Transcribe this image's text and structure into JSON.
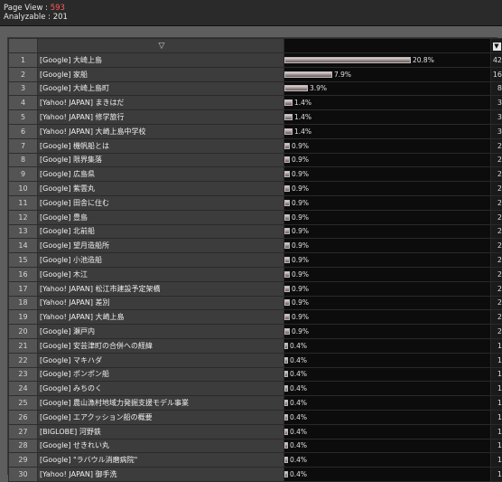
{
  "summary": {
    "page_view_label": "Page View : ",
    "page_view_value": "593",
    "analyzable_label": "Analyzable : 201"
  },
  "table": {
    "sort_icon": "▽",
    "count_sort_icon": "▼",
    "max_percent": 20.8,
    "rows": [
      {
        "idx": "1",
        "keyword": "[Google] 大崎上島",
        "pct": 20.8,
        "pct_label": "20.8%",
        "count": "42"
      },
      {
        "idx": "2",
        "keyword": "[Google] 家船",
        "pct": 7.9,
        "pct_label": "7.9%",
        "count": "16"
      },
      {
        "idx": "3",
        "keyword": "[Google] 大崎上島町",
        "pct": 3.9,
        "pct_label": "3.9%",
        "count": "8"
      },
      {
        "idx": "4",
        "keyword": "[Yahoo! JAPAN] まきはだ",
        "pct": 1.4,
        "pct_label": "1.4%",
        "count": "3"
      },
      {
        "idx": "5",
        "keyword": "[Yahoo! JAPAN] 修学旅行",
        "pct": 1.4,
        "pct_label": "1.4%",
        "count": "3"
      },
      {
        "idx": "6",
        "keyword": "[Yahoo! JAPAN] 大崎上島中学校",
        "pct": 1.4,
        "pct_label": "1.4%",
        "count": "3"
      },
      {
        "idx": "7",
        "keyword": "[Google] 機帆船とは",
        "pct": 0.9,
        "pct_label": "0.9%",
        "count": "2"
      },
      {
        "idx": "8",
        "keyword": "[Google] 限界集落",
        "pct": 0.9,
        "pct_label": "0.9%",
        "count": "2"
      },
      {
        "idx": "9",
        "keyword": "[Google] 広島県",
        "pct": 0.9,
        "pct_label": "0.9%",
        "count": "2"
      },
      {
        "idx": "10",
        "keyword": "[Google] 紫雲丸",
        "pct": 0.9,
        "pct_label": "0.9%",
        "count": "2"
      },
      {
        "idx": "11",
        "keyword": "[Google] 田舎に住む",
        "pct": 0.9,
        "pct_label": "0.9%",
        "count": "2"
      },
      {
        "idx": "12",
        "keyword": "[Google] 豊島",
        "pct": 0.9,
        "pct_label": "0.9%",
        "count": "2"
      },
      {
        "idx": "13",
        "keyword": "[Google] 北前船",
        "pct": 0.9,
        "pct_label": "0.9%",
        "count": "2"
      },
      {
        "idx": "14",
        "keyword": "[Google] 望月造船所",
        "pct": 0.9,
        "pct_label": "0.9%",
        "count": "2"
      },
      {
        "idx": "15",
        "keyword": "[Google] 小池造船",
        "pct": 0.9,
        "pct_label": "0.9%",
        "count": "2"
      },
      {
        "idx": "16",
        "keyword": "[Google] 木江",
        "pct": 0.9,
        "pct_label": "0.9%",
        "count": "2"
      },
      {
        "idx": "17",
        "keyword": "[Yahoo! JAPAN] 松江市建設予定架橋",
        "pct": 0.9,
        "pct_label": "0.9%",
        "count": "2"
      },
      {
        "idx": "18",
        "keyword": "[Yahoo! JAPAN] 差別",
        "pct": 0.9,
        "pct_label": "0.9%",
        "count": "2"
      },
      {
        "idx": "19",
        "keyword": "[Yahoo! JAPAN] 大崎上島",
        "pct": 0.9,
        "pct_label": "0.9%",
        "count": "2"
      },
      {
        "idx": "20",
        "keyword": "[Google] 瀬戸内",
        "pct": 0.9,
        "pct_label": "0.9%",
        "count": "2"
      },
      {
        "idx": "21",
        "keyword": "[Google] 安芸津町の合併への経緯",
        "pct": 0.4,
        "pct_label": "0.4%",
        "count": "1"
      },
      {
        "idx": "22",
        "keyword": "[Google] マキハダ",
        "pct": 0.4,
        "pct_label": "0.4%",
        "count": "1"
      },
      {
        "idx": "23",
        "keyword": "[Google] ポンポン船",
        "pct": 0.4,
        "pct_label": "0.4%",
        "count": "1"
      },
      {
        "idx": "24",
        "keyword": "[Google] みちのく",
        "pct": 0.4,
        "pct_label": "0.4%",
        "count": "1"
      },
      {
        "idx": "25",
        "keyword": "[Google] 農山漁村地域力発掘支援モデル事業",
        "pct": 0.4,
        "pct_label": "0.4%",
        "count": "1"
      },
      {
        "idx": "26",
        "keyword": "[Google] エアクッション船の概要",
        "pct": 0.4,
        "pct_label": "0.4%",
        "count": "1"
      },
      {
        "idx": "27",
        "keyword": "[BIGLOBE] 河野鉄",
        "pct": 0.4,
        "pct_label": "0.4%",
        "count": "1"
      },
      {
        "idx": "28",
        "keyword": "[Google] せきれい丸",
        "pct": 0.4,
        "pct_label": "0.4%",
        "count": "1"
      },
      {
        "idx": "29",
        "keyword": "[Google] \"ラバウル消磨病院\"",
        "pct": 0.4,
        "pct_label": "0.4%",
        "count": "1"
      },
      {
        "idx": "30",
        "keyword": "[Yahoo! JAPAN] 御手洗",
        "pct": 0.4,
        "pct_label": "0.4%",
        "count": "1"
      }
    ]
  }
}
